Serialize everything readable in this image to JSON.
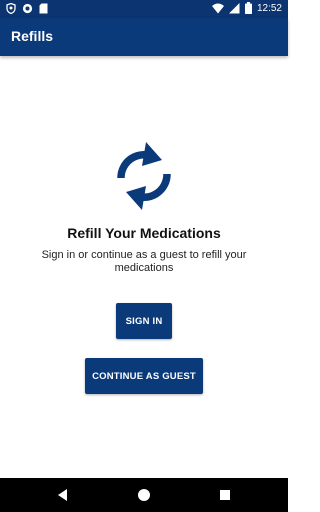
{
  "status_bar": {
    "time": "12:52",
    "left_icons": [
      "shield-icon",
      "circle-notification-icon",
      "sd-card-icon"
    ],
    "right_icons": [
      "wifi-icon",
      "signal-icon",
      "battery-icon"
    ]
  },
  "app_bar": {
    "title": "Refills"
  },
  "main": {
    "icon": "refresh-icon",
    "heading": "Refill Your Medications",
    "subtext": "Sign in or continue as a guest to refill your medications",
    "sign_in_label": "SIGN IN",
    "guest_label": "CONTINUE AS GUEST"
  },
  "nav_bar": {
    "icons": [
      "back-icon",
      "home-icon",
      "recents-icon"
    ]
  },
  "colors": {
    "primary": "#0b3a7a",
    "status_bar": "#0b3470",
    "nav_bar": "#000000"
  }
}
